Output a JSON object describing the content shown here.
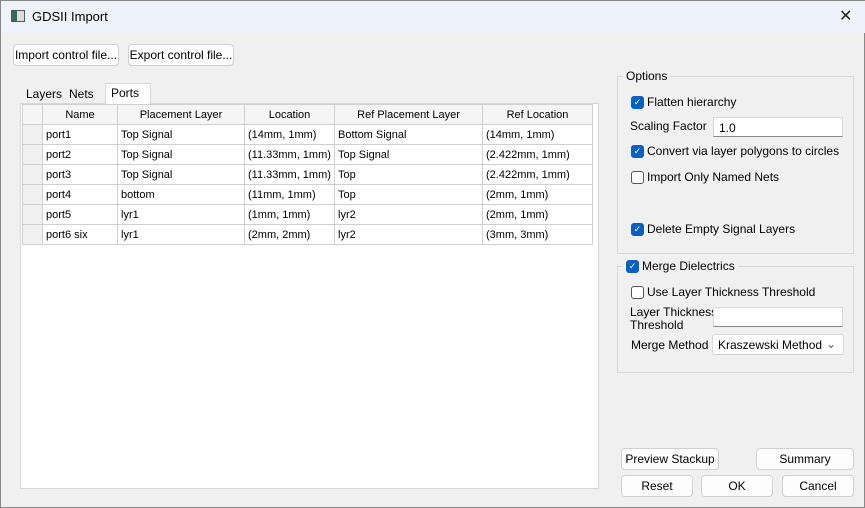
{
  "window": {
    "title": "GDSII Import",
    "close": "✕"
  },
  "toolbar": {
    "import": "Import control file...",
    "export": "Export control file..."
  },
  "tabs": [
    {
      "label": "Layers"
    },
    {
      "label": "Nets"
    },
    {
      "label": "Ports",
      "active": true
    }
  ],
  "table": {
    "headers": [
      "Name",
      "Placement Layer",
      "Location",
      "Ref Placement Layer",
      "Ref Location"
    ],
    "rows": [
      [
        "port1",
        "Top Signal",
        "(14mm, 1mm)",
        "Bottom Signal",
        "(14mm, 1mm)"
      ],
      [
        "port2",
        "Top Signal",
        "(11.33mm, 1mm)",
        "Top Signal",
        "(2.422mm, 1mm)"
      ],
      [
        "port3",
        "Top Signal",
        "(11.33mm, 1mm)",
        "Top",
        "(2.422mm, 1mm)"
      ],
      [
        "port4",
        "bottom",
        "(11mm, 1mm)",
        "Top",
        "(2mm, 1mm)"
      ],
      [
        "port5",
        "lyr1",
        "(1mm, 1mm)",
        "lyr2",
        "(2mm, 1mm)"
      ],
      [
        "port6 six",
        "lyr1",
        "(2mm, 2mm)",
        "lyr2",
        "(3mm, 3mm)"
      ]
    ]
  },
  "options": {
    "title": "Options",
    "flatten": "Flatten hierarchy",
    "scaling_label": "Scaling Factor",
    "scaling_value": "1.0",
    "convert": "Convert via layer polygons to circles",
    "named_nets": "Import Only Named Nets",
    "delete_empty": "Delete Empty Signal Layers"
  },
  "merge": {
    "title": "Merge Dielectrics",
    "use_threshold": "Use Layer Thickness Threshold",
    "threshold_label_1": "Layer Thickness",
    "threshold_label_2": "Threshold",
    "threshold_value": "",
    "method_label": "Merge Method",
    "method_value": "Kraszewski Method"
  },
  "buttons": {
    "preview": "Preview Stackup",
    "summary": "Summary",
    "reset": "Reset",
    "ok": "OK",
    "cancel": "Cancel"
  },
  "colors": {
    "accent": "#0a5fc2"
  }
}
